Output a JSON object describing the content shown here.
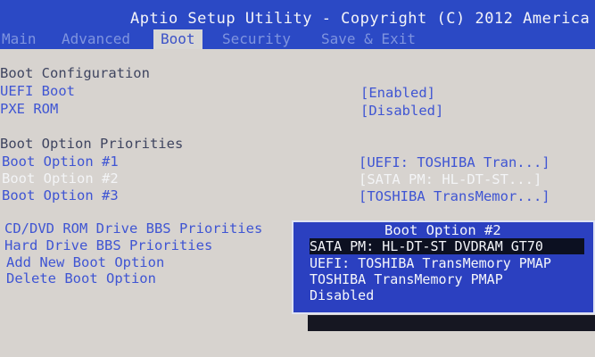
{
  "title": "Aptio Setup Utility - Copyright (C) 2012 America",
  "tabs": [
    {
      "label": "Main"
    },
    {
      "label": "Advanced"
    },
    {
      "label": "Boot"
    },
    {
      "label": "Security"
    },
    {
      "label": "Save & Exit"
    }
  ],
  "boot": {
    "configuration_heading": "Boot Configuration",
    "uefi_boot": {
      "label": "UEFI Boot",
      "value": "[Enabled]"
    },
    "pxe_rom": {
      "label": "PXE ROM",
      "value": "[Disabled]"
    },
    "priorities_heading": "Boot Option Priorities",
    "options": [
      {
        "label": "Boot Option #1",
        "value": "[UEFI: TOSHIBA Tran...]"
      },
      {
        "label": "Boot Option #2",
        "value": "[SATA  PM: HL-DT-ST...]"
      },
      {
        "label": "Boot Option #3",
        "value": "[TOSHIBA TransMemor...]"
      }
    ],
    "links": [
      {
        "label": "CD/DVD ROM Drive BBS Priorities"
      },
      {
        "label": "Hard Drive BBS Priorities"
      },
      {
        "label": "Add New Boot Option"
      },
      {
        "label": "Delete Boot Option"
      }
    ]
  },
  "popup": {
    "title": "Boot Option #2",
    "options": [
      {
        "label": "SATA  PM: HL-DT-ST DVDRAM GT70"
      },
      {
        "label": "UEFI: TOSHIBA TransMemory PMAP"
      },
      {
        "label": "TOSHIBA TransMemory PMAP"
      },
      {
        "label": "Disabled"
      }
    ]
  },
  "colors": {
    "header_blue": "#2b49c5",
    "body_bg": "#d7d3cf",
    "item_blue": "#3f55d3",
    "popup_blue": "#2b40c0",
    "text_white": "#f4f4f8"
  }
}
